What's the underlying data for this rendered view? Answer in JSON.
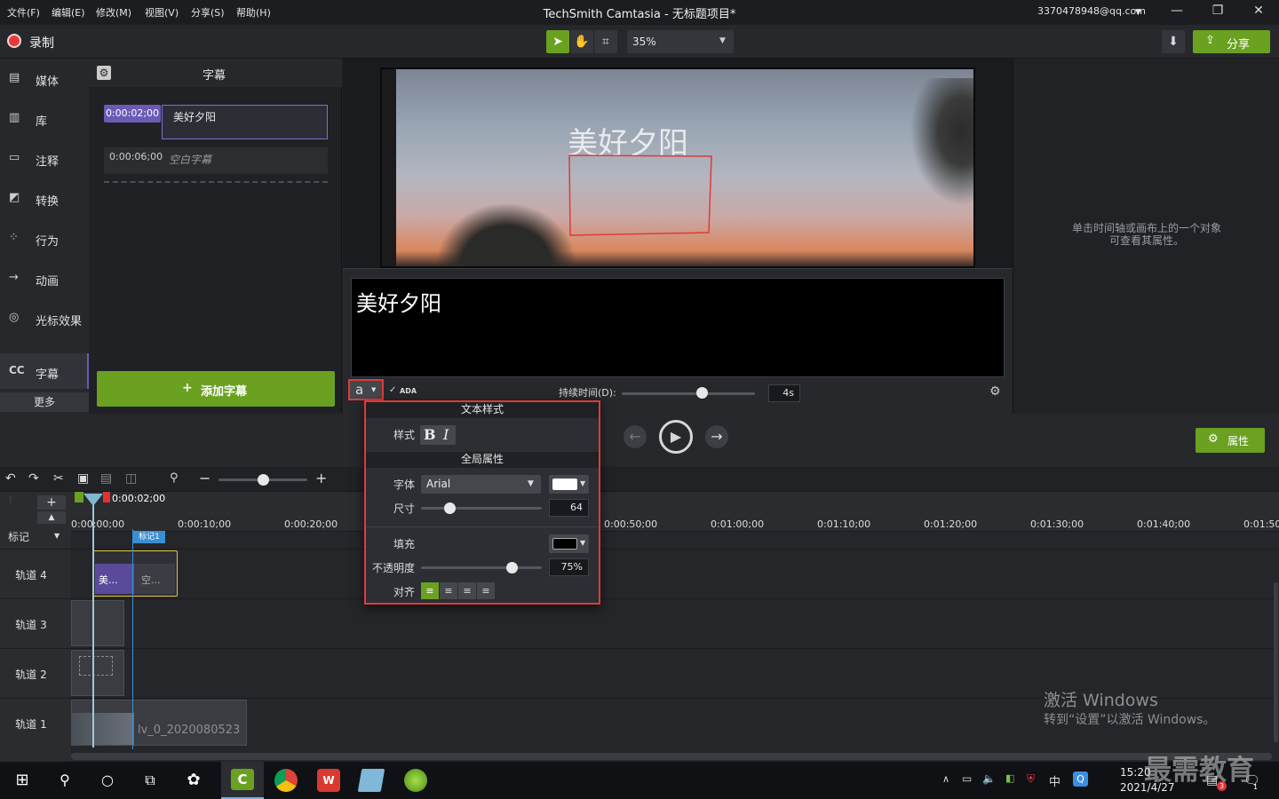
{
  "app": {
    "title": "TechSmith Camtasia - 无标题项目*",
    "menu": [
      "文件(F)",
      "编辑(E)",
      "修改(M)",
      "视图(V)",
      "分享(S)",
      "帮助(H)"
    ],
    "account": "3370478948@qq.com"
  },
  "toolbar": {
    "record_label": "录制",
    "zoom_value": "35%",
    "share_label": "分享"
  },
  "sidebar": {
    "items": [
      {
        "label": "媒体",
        "icon": "film-icon"
      },
      {
        "label": "库",
        "icon": "library-icon"
      },
      {
        "label": "注释",
        "icon": "annotation-icon"
      },
      {
        "label": "转换",
        "icon": "transition-icon"
      },
      {
        "label": "行为",
        "icon": "behavior-icon"
      },
      {
        "label": "动画",
        "icon": "animation-icon"
      },
      {
        "label": "光标效果",
        "icon": "cursor-effect-icon"
      },
      {
        "label": "字幕",
        "icon": "cc-icon"
      }
    ],
    "more_label": "更多",
    "cc_text": "CC"
  },
  "captions": {
    "header": "字幕",
    "items": [
      {
        "time": "0:00:02;00",
        "text": "美好夕阳"
      },
      {
        "time": "0:00:06;00",
        "text": "空白字幕"
      }
    ],
    "add_button": "添加字幕"
  },
  "canvas": {
    "caption_overlay": "美好夕阳"
  },
  "editor": {
    "text": "美好夕阳",
    "style_btn": "a",
    "ada_label": "ADA",
    "duration_label": "持续时间(D):",
    "duration_value": "4s",
    "duration_fraction": 0.6
  },
  "popup": {
    "section_text_style": "文本样式",
    "style_label": "样式",
    "bold": "B",
    "italic": "I",
    "section_global": "全局属性",
    "font_label": "字体",
    "font_value": "Arial",
    "font_color": "#ffffff",
    "size_label": "尺寸",
    "size_value": "64",
    "fill_label": "填充",
    "fill_color": "#000000",
    "opacity_label": "不透明度",
    "opacity_value": "75%",
    "opacity_fraction": 0.75,
    "align_label": "对齐"
  },
  "properties": {
    "hint_line1": "单击时间轴或画布上的一个对象",
    "hint_line2": "可查看其属性。",
    "button": "属性"
  },
  "timeline": {
    "playhead_time": "0:00:02;00",
    "ticks": [
      "0:00:00;00",
      "0:00:10;00",
      "0:00:20;00",
      "0:00:50;00",
      "0:01:00;00",
      "0:01:10;00",
      "0:01:20;00",
      "0:01:30;00",
      "0:01:40;00",
      "0:01:50;"
    ],
    "marker_label": "标记",
    "marker_flag": "标记1",
    "tracks": [
      "轨道 4",
      "轨道 3",
      "轨道 2",
      "轨道 1"
    ],
    "clip_caption_1": "美...",
    "clip_caption_2": "空...",
    "clip_video": "lv_0_2020080523"
  },
  "watermark": {
    "line1": "激活 Windows",
    "line2": "转到“设置”以激活 Windows。",
    "brand": "最需教育"
  },
  "taskbar": {
    "time": "15:20",
    "date": "2021/4/27",
    "ime": "中",
    "badge": "3",
    "notif": "1"
  },
  "colors": {
    "accent_green": "#6aa121",
    "caption_purple": "#5b4a9a",
    "highlight_red": "#e03a3a"
  }
}
